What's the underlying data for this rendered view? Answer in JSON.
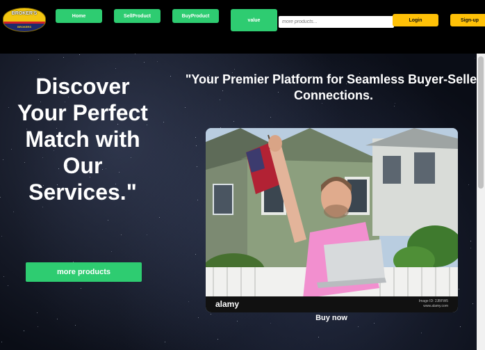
{
  "logo": {
    "line1": "BROKER'S",
    "line2": "BROKERS"
  },
  "nav": {
    "home": "Home",
    "sell": "SellProduct",
    "buy": "BuyProduct",
    "value": "value"
  },
  "search": {
    "placeholder": "more products..."
  },
  "auth": {
    "login": "Login",
    "signup": "Sign-up"
  },
  "hero": {
    "heading": "Discover Your Perfect Match with Our Services.\"",
    "cta": "more products",
    "tagline_line1": "\"Your Premier Platform for Seamless Buyer-Seller",
    "tagline_line2": "Connections.",
    "buy_now": "Buy now"
  },
  "photo": {
    "watermark": "alamy",
    "image_id": "Image ID: 2JBFW5",
    "site": "www.alamy.com"
  },
  "colors": {
    "green": "#2ecc71",
    "yellow": "#ffc107",
    "header_bg": "#000000"
  }
}
